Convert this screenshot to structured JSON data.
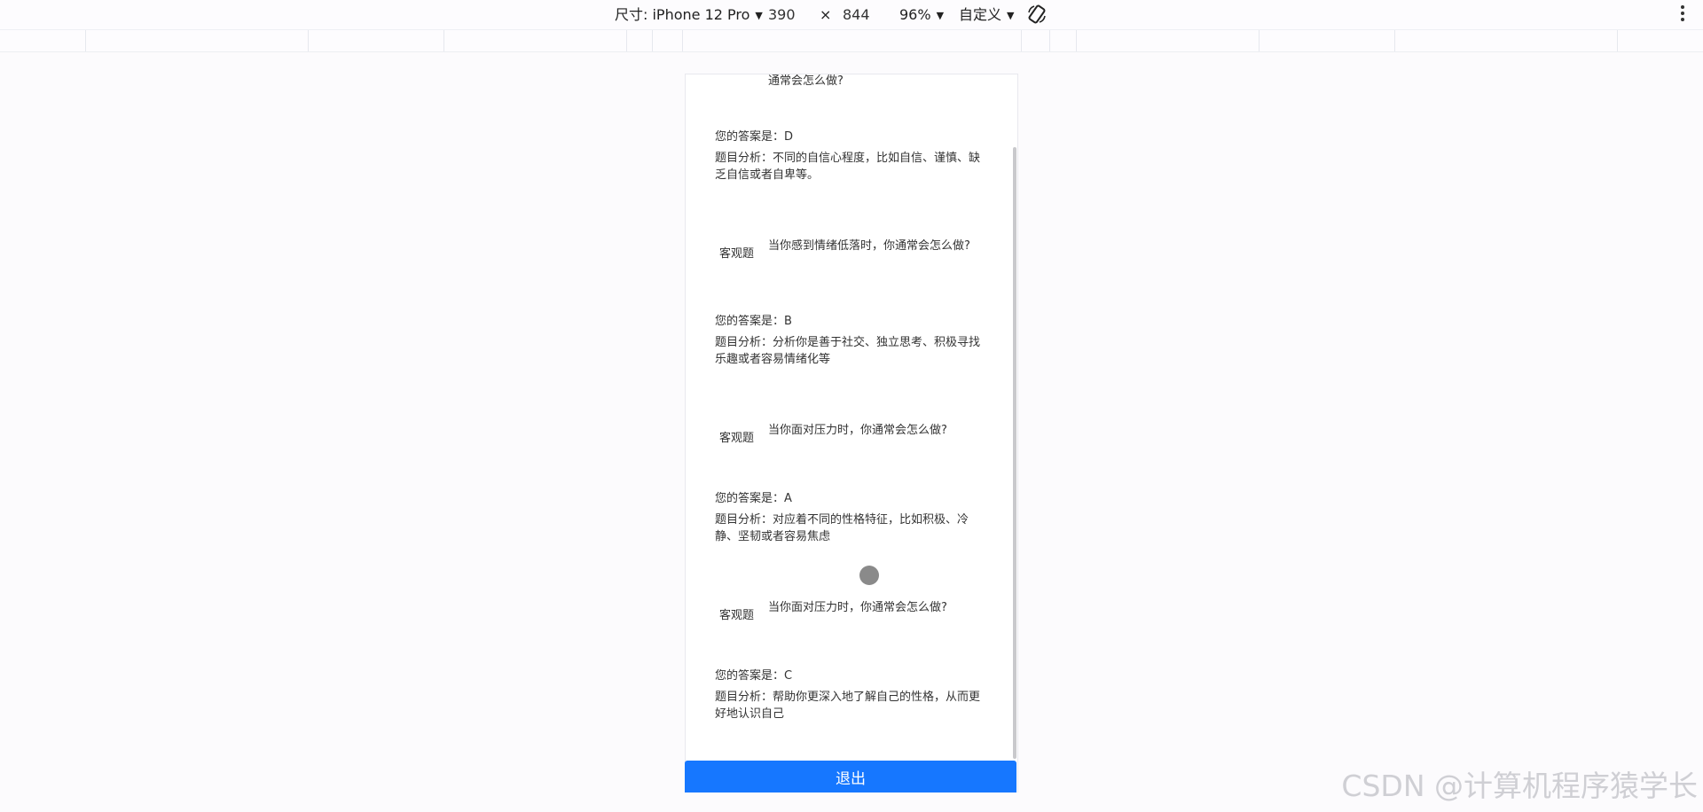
{
  "toolbar": {
    "size_label": "尺寸: iPhone 12 Pro",
    "width": "390",
    "times": "×",
    "height": "844",
    "zoom": "96%",
    "mode": "自定义"
  },
  "page": {
    "cut_question": "通常会怎么做?",
    "items": [
      {
        "type": "",
        "question": "",
        "answer": "您的答案是：D",
        "analysis": "题目分析：不同的自信心程度，比如自信、谨慎、缺乏自信或者自卑等。"
      },
      {
        "type": "客观题",
        "question": "当你感到情绪低落时，你通常会怎么做?",
        "answer": "您的答案是：B",
        "analysis": "题目分析：分析你是善于社交、独立思考、积极寻找乐趣或者容易情绪化等"
      },
      {
        "type": "客观题",
        "question": "当你面对压力时，你通常会怎么做?",
        "answer": "您的答案是：A",
        "analysis": "题目分析：对应着不同的性格特征，比如积极、冷静、坚韧或者容易焦虑"
      },
      {
        "type": "客观题",
        "question": "当你面对压力时，你通常会怎么做?",
        "answer": "您的答案是：C",
        "analysis": "题目分析：帮助你更深入地了解自己的性格，从而更好地认识自己"
      }
    ],
    "exit_label": "退出"
  },
  "watermark": "CSDN @计算机程序猿学长",
  "colors": {
    "primary": "#1677ff",
    "background": "#fcfbfd"
  }
}
